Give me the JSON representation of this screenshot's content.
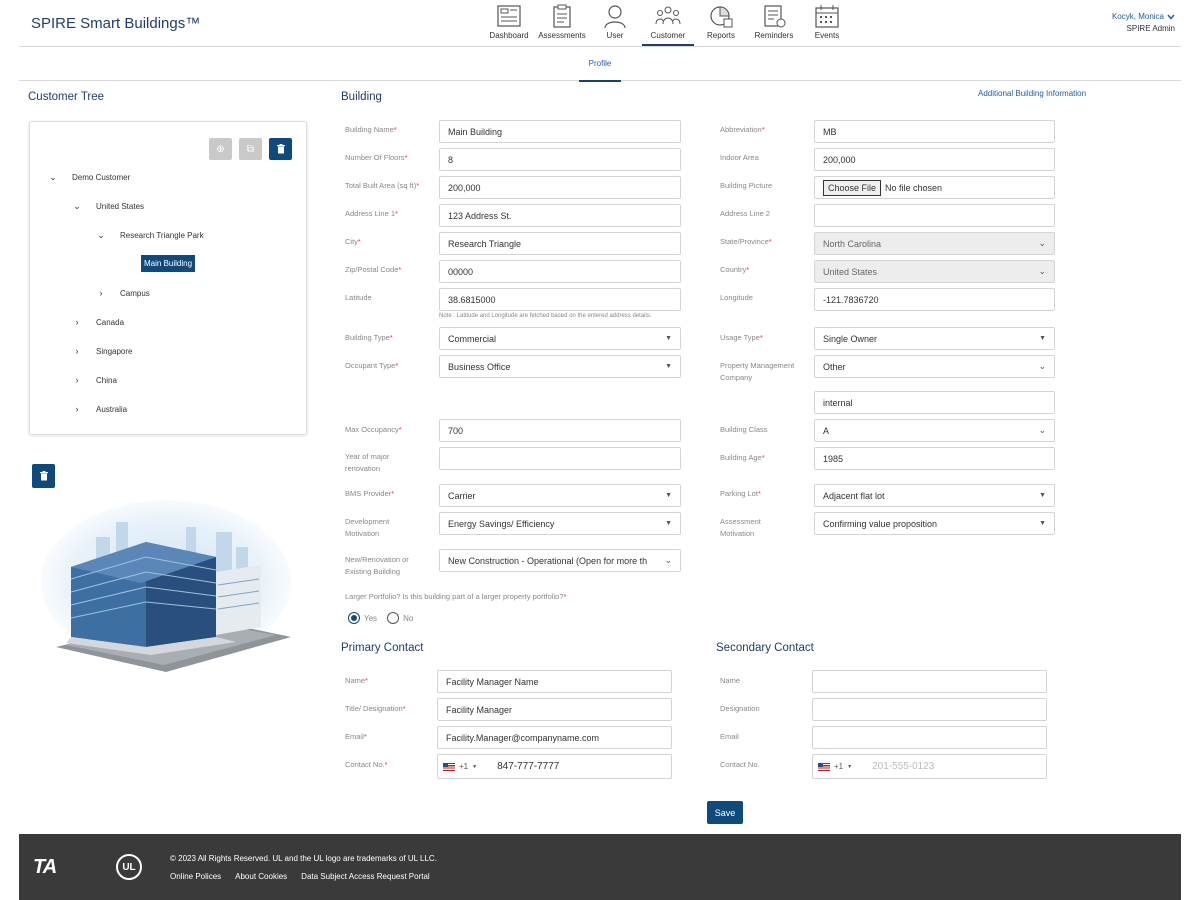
{
  "header": {
    "brand": "SPIRE Smart Buildings™",
    "nav": [
      {
        "label": "Dashboard",
        "icon": "dashboard-icon"
      },
      {
        "label": "Assessments",
        "icon": "clipboard-icon"
      },
      {
        "label": "User",
        "icon": "user-icon"
      },
      {
        "label": "Customer",
        "icon": "people-icon",
        "active": true
      },
      {
        "label": "Reports",
        "icon": "report-icon"
      },
      {
        "label": "Reminders",
        "icon": "reminder-icon"
      },
      {
        "label": "Events",
        "icon": "calendar-icon"
      }
    ],
    "user_name": "Kocyk, Monica",
    "user_role": "SPIRE Admin"
  },
  "subtabs": {
    "profile": "Profile"
  },
  "tree": {
    "title": "Customer Tree",
    "nodes": {
      "demo_customer": "Demo Customer",
      "united_states": "United States",
      "research_triangle_park": "Research Triangle Park",
      "main_building": "Main Building",
      "campus": "Campus",
      "canada": "Canada",
      "singapore": "Singapore",
      "china": "China",
      "australia": "Australia"
    }
  },
  "building": {
    "title": "Building",
    "additional_link": "Additional Building Information",
    "labels": {
      "building_name": "Building Name",
      "abbreviation": "Abbreviation",
      "floors": "Number Of Floors",
      "indoor_area": "Indoor Area",
      "total_area": "Total Built Area (sq ft)",
      "building_picture": "Building Picture",
      "address1": "Address Line 1",
      "address2": "Address Line 2",
      "city": "City",
      "state": "State/Province",
      "zip": "Zip/Postal Code",
      "country": "Country",
      "latitude": "Latitude",
      "longitude": "Longitude",
      "building_type": "Building Type",
      "usage_type": "Usage Type",
      "occupant_type": "Occupant Type",
      "property_mgmt_1": "Property Management",
      "property_mgmt_2": "Company",
      "max_occupancy": "Max Occupancy",
      "building_class": "Building Class",
      "year_major_1": "Year of major",
      "year_major_2": "renovation",
      "building_age": "Building Age",
      "bms_provider": "BMS Provider",
      "parking_lot": "Parking Lot",
      "dev_motivation_1": "Development",
      "dev_motivation_2": "Motivation",
      "assess_motivation_1": "Assessment",
      "assess_motivation_2": "Motivation",
      "new_reno_1": "New/Renovation or",
      "new_reno_2": "Existing Building",
      "larger_portfolio": "Larger Portfolio? Is this building part of a larger property portfolio?"
    },
    "values": {
      "building_name": "Main Building",
      "abbreviation": "MB",
      "floors": "8",
      "indoor_area": "200,000",
      "total_area": "200,000",
      "choose_file": "Choose File",
      "no_file": "No file chosen",
      "address1": "123 Address St.",
      "address2": "",
      "city": "Research Triangle",
      "state": "North Carolina",
      "zip": "00000",
      "country": "United States",
      "latitude": "38.6815000",
      "longitude": "-121.7836720",
      "note": "Note : Latitude and Longitude are fetched based on the entered address details.",
      "building_type": "Commercial",
      "usage_type": "Single Owner",
      "occupant_type": "Business Office",
      "property_mgmt": "Other",
      "property_mgmt_other": "internal",
      "max_occupancy": "700",
      "building_class": "A",
      "year_major": "",
      "building_age": "1985",
      "bms_provider": "Carrier",
      "parking_lot": "Adjacent flat lot",
      "dev_motivation": "Energy Savings/ Efficiency",
      "assess_motivation": "Confirming value proposition",
      "new_reno": "New Construction - Operational (Open for more th",
      "yes": "Yes",
      "no": "No"
    }
  },
  "primary_contact": {
    "title": "Primary Contact",
    "name_label": "Name",
    "title_label": "Title/ Designation",
    "email_label": "Email",
    "phone_label": "Contact No.",
    "name": "Facility Manager Name",
    "designation": "Facility Manager",
    "email": "Facility.Manager@companyname.com",
    "dial_code": "+1",
    "phone": "847-777-7777"
  },
  "secondary_contact": {
    "title": "Secondary Contact",
    "name_label": "Name",
    "title_label": "Designation",
    "email_label": "Email",
    "phone_label": "Contact No.",
    "dial_code": "+1",
    "phone_placeholder": "201-555-0123"
  },
  "save_label": "Save",
  "footer": {
    "ta_logo": "TA",
    "ul_logo": "UL",
    "copyright": "© 2023 All Rights Reserved. UL and the UL logo are trademarks of UL LLC.",
    "links": [
      "Online Polices",
      "About Cookies",
      "Data Subject Access Request Portal"
    ]
  },
  "colors": {
    "primary": "#0e4a7c",
    "brand_text": "#1f3f6b",
    "link": "#1f5ea8",
    "required": "#e53935",
    "footer_bg": "#3a3a3a"
  }
}
